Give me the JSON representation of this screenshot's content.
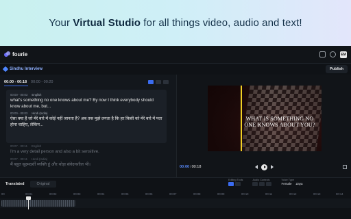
{
  "hero": {
    "prefix": "Your ",
    "highlight": "Virtual Studio",
    "suffix": " for all things video, audio and text!"
  },
  "topbar": {
    "app_name": "fourie",
    "icons": [
      "home-icon",
      "help-icon"
    ],
    "avatar_initials": "EM"
  },
  "project": {
    "title": "Sindhu Interview",
    "publish_label": "Publish"
  },
  "transcript": {
    "active_range": "00:00 - 00:18",
    "next_range": "00:00 - 00:20",
    "segments": [
      {
        "time": "00:00 - 00:03",
        "lang": "English",
        "text": "what's something no one knows about me? By now I think everybody should know about me, but..."
      },
      {
        "time": "00:00 - 00:03",
        "lang": "Hindi (India)",
        "text": "ऐसा क्या है जो मेरे बारे में कोई नहीं जानता है? अब तक मुझे लगता है कि हर किसी को मेरे बारे में पता होना चाहिए, लेकिन..."
      },
      {
        "time": "00:07 - 00:11",
        "lang": "English",
        "text": "I'm a very detail person and also a bit sensitive."
      },
      {
        "time": "00:07 - 00:11",
        "lang": "Hindi (India)",
        "text": "मैं बहुत सूक्ष्मदर्शी व्यक्ति हूं और थोड़ा संवेदनशील भी।"
      }
    ]
  },
  "player": {
    "caption": "WHAT IS SOMETHING NO ONE KNOWS ABOUT YOU?",
    "current_time": "00:00",
    "separator": "/",
    "total_time": "00:18"
  },
  "timeline": {
    "tab_active": "Translated",
    "tab_inactive": "Original",
    "tools": [
      {
        "label": "Editing Tools"
      },
      {
        "label": "Audio Controls"
      },
      {
        "label": "Voice Type",
        "value1": "Female",
        "value2": "Zaya"
      }
    ],
    "ticks": [
      "00",
      "00:01",
      "00:02",
      "00:03",
      "00:04",
      "00:05",
      "00:06",
      "00:07",
      "00:08",
      "00:09",
      "00:10",
      "00:11",
      "00:12",
      "00:13",
      "00:14"
    ]
  },
  "colors": {
    "accent": "#3b6cf0",
    "playhead_line": "#f2d024"
  }
}
